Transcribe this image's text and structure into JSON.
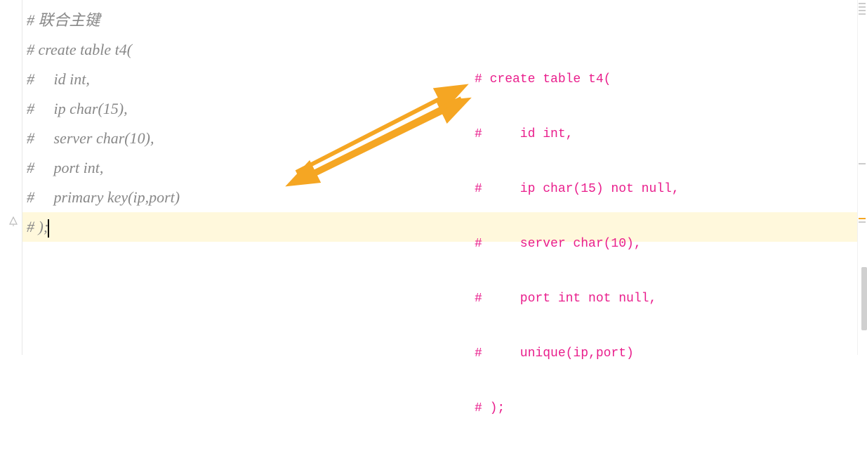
{
  "left_code": {
    "lines": [
      "# 联合主键",
      "# create table t4(",
      "#     id int,",
      "#     ip char(15),",
      "#     server char(10),",
      "#     port int,",
      "#     primary key(ip,port)",
      "# );"
    ]
  },
  "right_code": {
    "lines": [
      "# create table t4(",
      "#     id int,",
      "#     ip char(15) not null,",
      "#     server char(10),",
      "#     port int not null,",
      "#     unique(ip,port)",
      "# );"
    ]
  },
  "current_line_index": 7
}
